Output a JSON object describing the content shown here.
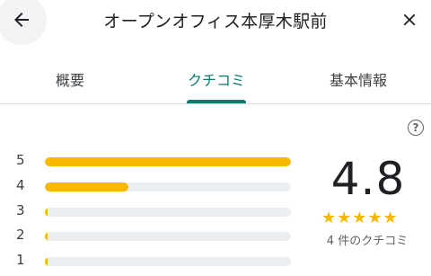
{
  "header": {
    "title": "オープンオフィス本厚木駅前"
  },
  "tabs": [
    {
      "label": "概要"
    },
    {
      "label": "クチコミ",
      "active": true
    },
    {
      "label": "基本情報"
    }
  ],
  "reviews": {
    "help_symbol": "?",
    "average": "4.8",
    "stars_glyph": "★★★★★",
    "count_label": "4 件のクチコミ",
    "distribution": [
      {
        "stars": "5",
        "fraction": 1.0
      },
      {
        "stars": "4",
        "fraction": 0.34
      },
      {
        "stars": "3",
        "fraction": 0.01
      },
      {
        "stars": "2",
        "fraction": 0.01
      },
      {
        "stars": "1",
        "fraction": 0.01
      }
    ]
  },
  "colors": {
    "accent": "#0b7a6f",
    "star": "#f7b900",
    "track": "#eceff1"
  }
}
